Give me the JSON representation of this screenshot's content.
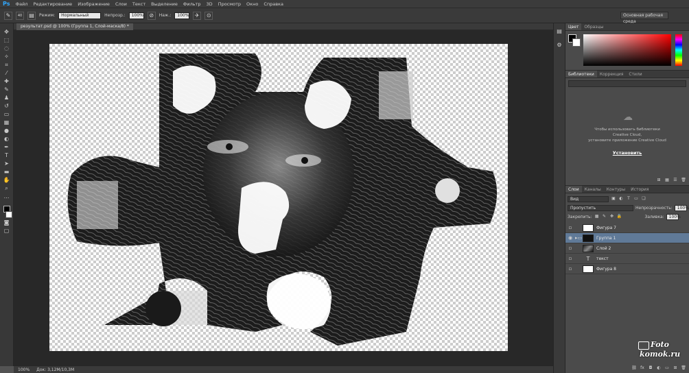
{
  "app": {
    "logo": "Ps"
  },
  "menu": [
    "Файл",
    "Редактирование",
    "Изображение",
    "Слои",
    "Текст",
    "Выделение",
    "Фильтр",
    "3D",
    "Просмотр",
    "Окно",
    "Справка"
  ],
  "options": {
    "mode_label": "Режим:",
    "mode_value": "Нормальный",
    "opacity_label": "Непрозр.:",
    "opacity_value": "100%",
    "flow_label": "Наж.:",
    "flow_value": "100%",
    "brush_size": "40",
    "workspace": "Основная рабочая среда"
  },
  "document_tab": {
    "title": "результат.psd @ 100% (Группа 1, Слой-маска/8) *"
  },
  "statusbar": {
    "zoom": "100%",
    "doc_size": "Док: 3,12M/10,3M"
  },
  "color_panel": {
    "tabs": [
      "Цвет",
      "Образцы"
    ]
  },
  "libraries_panel": {
    "tabs": [
      "Библиотеки",
      "Коррекция",
      "Стили"
    ],
    "message_line1": "Чтобы использовать библиотеки",
    "message_line2": "Creative Cloud,",
    "message_line3": "установите приложение Creative Cloud",
    "install_link": "Установить"
  },
  "layers_panel": {
    "tabs": [
      "Слои",
      "Каналы",
      "Контуры",
      "История"
    ],
    "filter_label": "Вид",
    "blend_mode": "Пропустить",
    "opacity_label": "Непрозрачность:",
    "opacity_value": "100%",
    "lock_label": "Закрепить:",
    "fill_label": "Заливка:",
    "fill_value": "100%",
    "layers": [
      {
        "name": "Фигура 7",
        "visible": false,
        "selected": false,
        "kind": "shape"
      },
      {
        "name": "Группа 1",
        "visible": true,
        "selected": true,
        "kind": "group"
      },
      {
        "name": "Слой 2",
        "visible": false,
        "selected": false,
        "kind": "image"
      },
      {
        "name": "текст",
        "visible": false,
        "selected": false,
        "kind": "text"
      },
      {
        "name": "Фигура 8",
        "visible": false,
        "selected": false,
        "kind": "shape"
      }
    ]
  },
  "watermark": {
    "line1": "Foto",
    "line2": "komok.ru"
  },
  "colors": {
    "selection": "#607a98",
    "canvas_bg": "#282828",
    "panel_bg": "#4b4b4b"
  }
}
